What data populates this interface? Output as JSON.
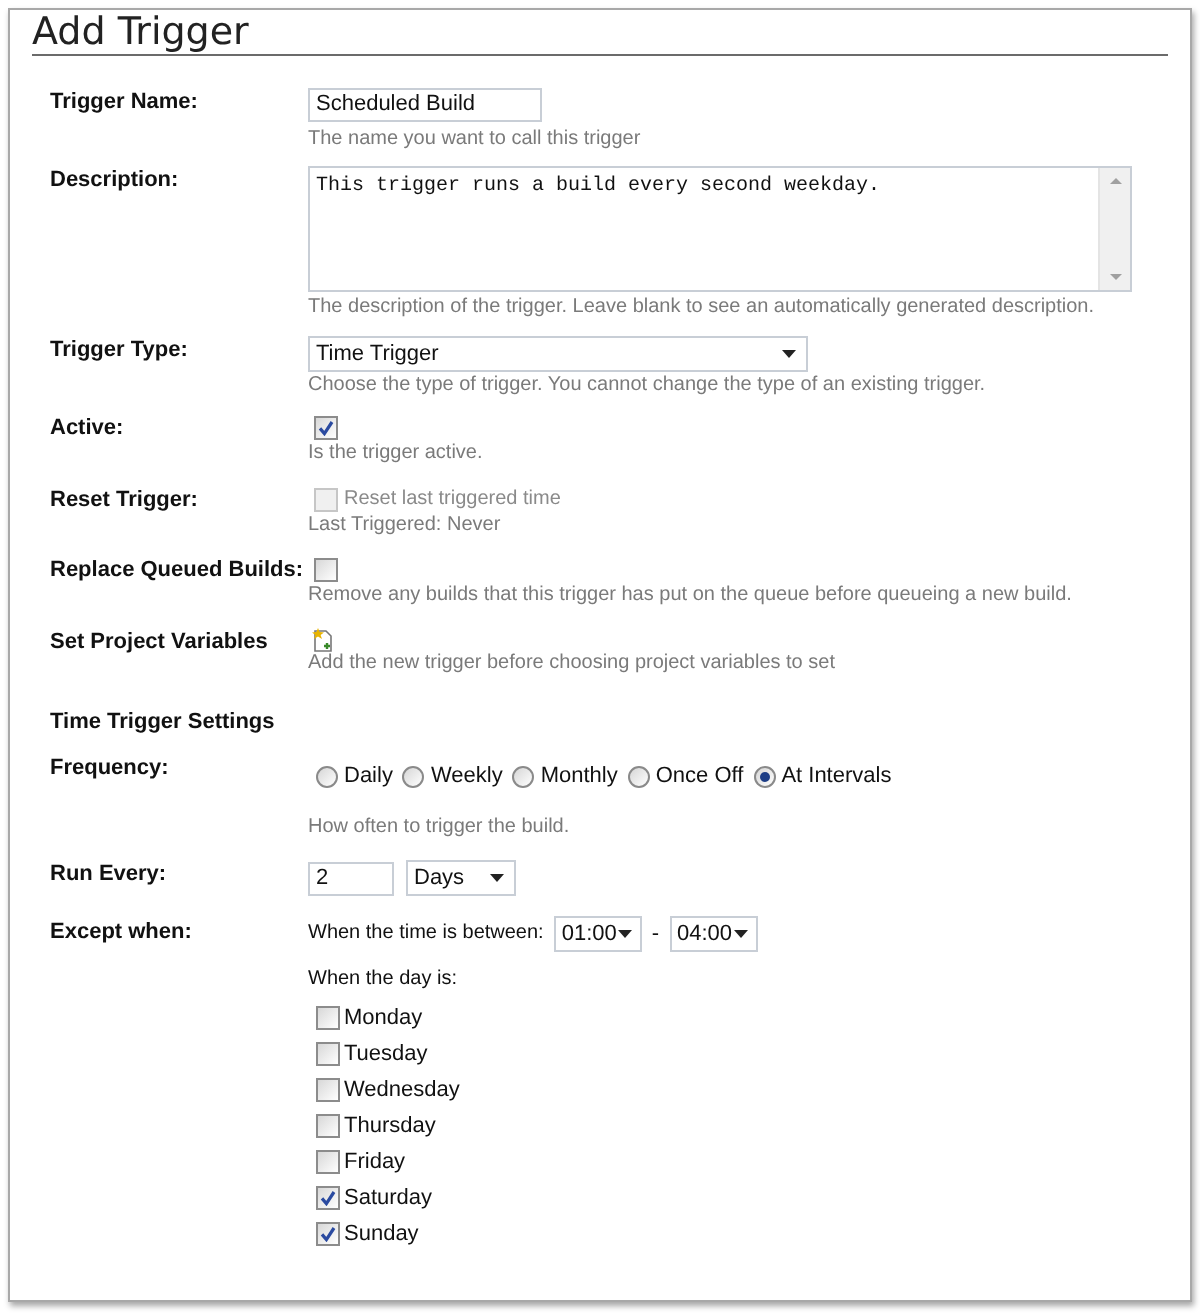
{
  "title": "Add Trigger",
  "fields": [
    {
      "kind": "text",
      "label": "Trigger Name:",
      "value": "Scheduled Build",
      "hint": "The name you want to call this trigger"
    },
    {
      "kind": "textarea",
      "label": "Description:",
      "value": "This trigger runs a build every second weekday.",
      "hint": "The description of the trigger. Leave blank to see an automatically generated description."
    },
    {
      "kind": "select",
      "label": "Trigger Type:",
      "value": "Time Trigger",
      "hint": "Choose the type of trigger. You cannot change the type of an existing trigger."
    },
    {
      "kind": "checkbox",
      "label": "Active:",
      "checked": true,
      "disabled": false,
      "hint": "Is the trigger active."
    },
    {
      "kind": "checkbox",
      "label": "Reset Trigger:",
      "checked": false,
      "disabled": true,
      "option": "Reset last triggered time",
      "hint": "Last Triggered: Never"
    },
    {
      "kind": "checkbox",
      "label": "Replace Queued Builds:",
      "checked": false,
      "disabled": false,
      "hint": "Remove any builds that this trigger has put on the queue before queueing a new build."
    },
    {
      "kind": "icon",
      "label": "Set Project Variables",
      "hint": "Add the new trigger before choosing project variables to set"
    }
  ],
  "time_trigger_settings": {
    "heading": "Time Trigger Settings",
    "frequency": {
      "label": "Frequency:",
      "options": [
        {
          "label": "Daily",
          "selected": false
        },
        {
          "label": "Weekly",
          "selected": false
        },
        {
          "label": "Monthly",
          "selected": false
        },
        {
          "label": "Once Off",
          "selected": false
        },
        {
          "label": "At Intervals",
          "selected": true
        }
      ],
      "hint": "How often to trigger the build."
    },
    "run_every": {
      "label": "Run Every:",
      "value": "2",
      "unit": "Days"
    },
    "except_when": {
      "label": "Except when:",
      "time_label": "When the time is between:",
      "from": "01:00",
      "separator": "-",
      "to": "04:00",
      "day_label": "When the day is:",
      "days": [
        {
          "label": "Monday",
          "checked": false
        },
        {
          "label": "Tuesday",
          "checked": false
        },
        {
          "label": "Wednesday",
          "checked": false
        },
        {
          "label": "Thursday",
          "checked": false
        },
        {
          "label": "Friday",
          "checked": false
        },
        {
          "label": "Saturday",
          "checked": true
        },
        {
          "label": "Sunday",
          "checked": true
        }
      ]
    }
  }
}
